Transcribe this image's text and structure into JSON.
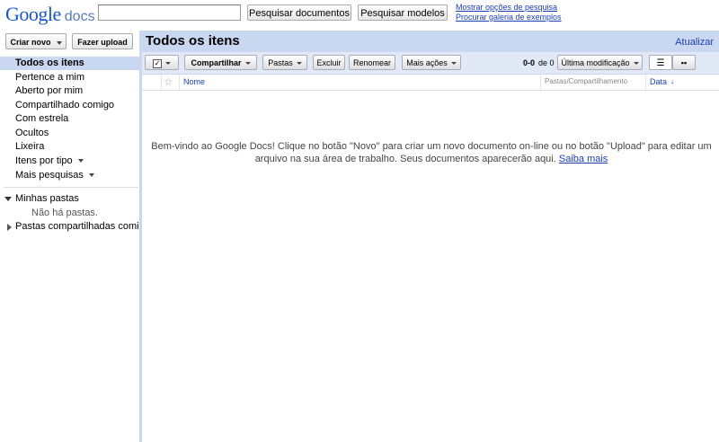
{
  "header": {
    "logo_google": "Google",
    "logo_docs": "docs",
    "search_value": "",
    "search_docs_label": "Pesquisar documentos",
    "search_templates_label": "Pesquisar modelos",
    "show_options_link": "Mostrar opções de pesquisa",
    "browse_gallery_link": "Procurar galeria de exemplos"
  },
  "sidebar": {
    "create_new_label": "Criar novo",
    "upload_label": "Fazer upload",
    "items": [
      {
        "label": "Todos os itens",
        "active": true
      },
      {
        "label": "Pertence a mim"
      },
      {
        "label": "Aberto por mim"
      },
      {
        "label": "Compartilhado comigo"
      },
      {
        "label": "Com estrela"
      },
      {
        "label": "Ocultos"
      },
      {
        "label": "Lixeira"
      },
      {
        "label": "Itens por tipo"
      },
      {
        "label": "Mais pesquisas"
      }
    ],
    "my_folders_label": "Minhas pastas",
    "no_folders_label": "Não há pastas.",
    "shared_folders_label": "Pastas compartilhadas comigo"
  },
  "main": {
    "title": "Todos os itens",
    "refresh_label": "Atualizar",
    "toolbar": {
      "share_label": "Compartilhar",
      "folders_label": "Pastas",
      "delete_label": "Excluir",
      "rename_label": "Renomear",
      "more_actions_label": "Mais ações",
      "count_range": "0-0",
      "count_of": "de 0",
      "sort_label": "Última modificação"
    },
    "columns": {
      "name": "Nome",
      "folders_sharing": "Pastas/Compartilhamento",
      "date": "Data",
      "date_sort": "↓"
    },
    "welcome_text": "Bem-vindo ao Google Docs! Clique no botão \"Novo\" para criar um novo documento on-line ou no botão \"Upload\" para editar um arquivo na sua área de trabalho. Seus documentos aparecerão aqui.",
    "learn_more_label": "Saiba mais"
  },
  "colors": {
    "accent_blue": "#c9d7f1",
    "toolbar_bg": "#e1e9f7",
    "link": "#1a3fb0"
  }
}
